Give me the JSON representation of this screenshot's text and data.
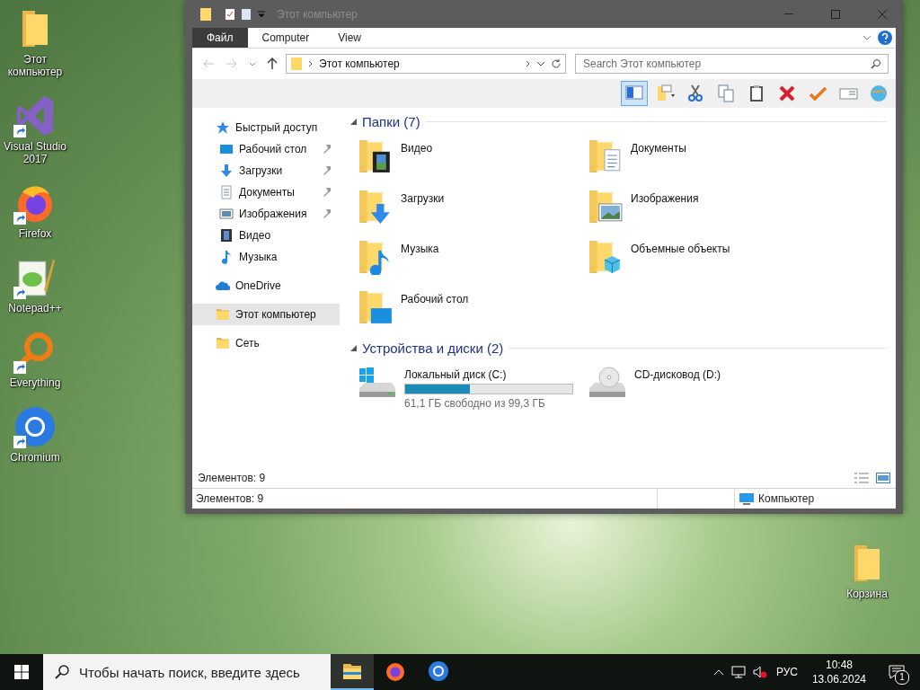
{
  "desktop_icons": [
    {
      "label": "Этот компьютер",
      "kind": "folder",
      "shortcut": false
    },
    {
      "label": "Visual Studio 2017",
      "kind": "vs",
      "shortcut": true
    },
    {
      "label": "Firefox",
      "kind": "firefox",
      "shortcut": true
    },
    {
      "label": "Notepad++",
      "kind": "notepad",
      "shortcut": true
    },
    {
      "label": "Everything",
      "kind": "everything",
      "shortcut": true
    },
    {
      "label": "Chromium",
      "kind": "chromium",
      "shortcut": true
    }
  ],
  "recycle_bin": {
    "label": "Корзина"
  },
  "window": {
    "title": "Этот компьютер",
    "ribbon_tabs": [
      {
        "label": "Файл",
        "selected": true
      },
      {
        "label": "Computer",
        "selected": false
      },
      {
        "label": "View",
        "selected": false
      }
    ],
    "address": {
      "path": "Этот компьютер"
    },
    "search": {
      "placeholder": "Search Этот компьютер"
    },
    "toolbar": [
      {
        "kind": "pane",
        "selected": true
      },
      {
        "kind": "newfolder",
        "selected": false
      },
      {
        "kind": "cut",
        "selected": false
      },
      {
        "kind": "copy",
        "selected": false
      },
      {
        "kind": "paste",
        "selected": false
      },
      {
        "kind": "delete",
        "selected": false
      },
      {
        "kind": "check",
        "selected": false
      },
      {
        "kind": "rename",
        "selected": false
      },
      {
        "kind": "globe",
        "selected": false
      }
    ],
    "nav": [
      {
        "label": "Быстрый доступ",
        "kind": "quick",
        "selected": false,
        "children": [
          {
            "label": "Рабочий стол",
            "kind": "desktop",
            "pinned": true,
            "selected": false
          },
          {
            "label": "Загрузки",
            "kind": "downloads",
            "pinned": true,
            "selected": false
          },
          {
            "label": "Документы",
            "kind": "documents",
            "pinned": true,
            "selected": false
          },
          {
            "label": "Изображения",
            "kind": "pictures",
            "pinned": true,
            "selected": false
          },
          {
            "label": "Видео",
            "kind": "video",
            "pinned": false,
            "selected": false
          },
          {
            "label": "Музыка",
            "kind": "music",
            "pinned": false,
            "selected": false
          }
        ]
      },
      {
        "label": "OneDrive",
        "kind": "onedrive",
        "selected": false
      },
      {
        "label": "Этот компьютер",
        "kind": "folder",
        "selected": true
      },
      {
        "label": "Сеть",
        "kind": "folder",
        "selected": false
      }
    ],
    "folders": {
      "title": "Папки (7)",
      "items": [
        {
          "label": "Видео",
          "kind": "video"
        },
        {
          "label": "Документы",
          "kind": "documents"
        },
        {
          "label": "Загрузки",
          "kind": "downloads"
        },
        {
          "label": "Изображения",
          "kind": "pictures"
        },
        {
          "label": "Музыка",
          "kind": "music"
        },
        {
          "label": "Объемные объекты",
          "kind": "objects"
        },
        {
          "label": "Рабочий стол",
          "kind": "desktop"
        }
      ]
    },
    "drives": {
      "title": "Устройства и диски (2)",
      "items": [
        {
          "label": "Локальный диск (C:)",
          "kind": "hdd",
          "level": 0.385,
          "free": "61,1 ГБ свободно из 99,3 ГБ"
        },
        {
          "label": "CD-дисковод (D:)",
          "kind": "cd"
        }
      ]
    },
    "item_count": "Элементов: 9",
    "status_bar": {
      "count": "Элементов: 9",
      "location": "Компьютер"
    }
  },
  "taskbar": {
    "search_placeholder": "Чтобы начать поиск, введите здесь",
    "apps": [
      {
        "kind": "explorer"
      },
      {
        "kind": "firefox"
      },
      {
        "kind": "chromium"
      }
    ],
    "language": "РУС",
    "time": "10:48",
    "date": "13.06.2024",
    "notifications": "1"
  }
}
